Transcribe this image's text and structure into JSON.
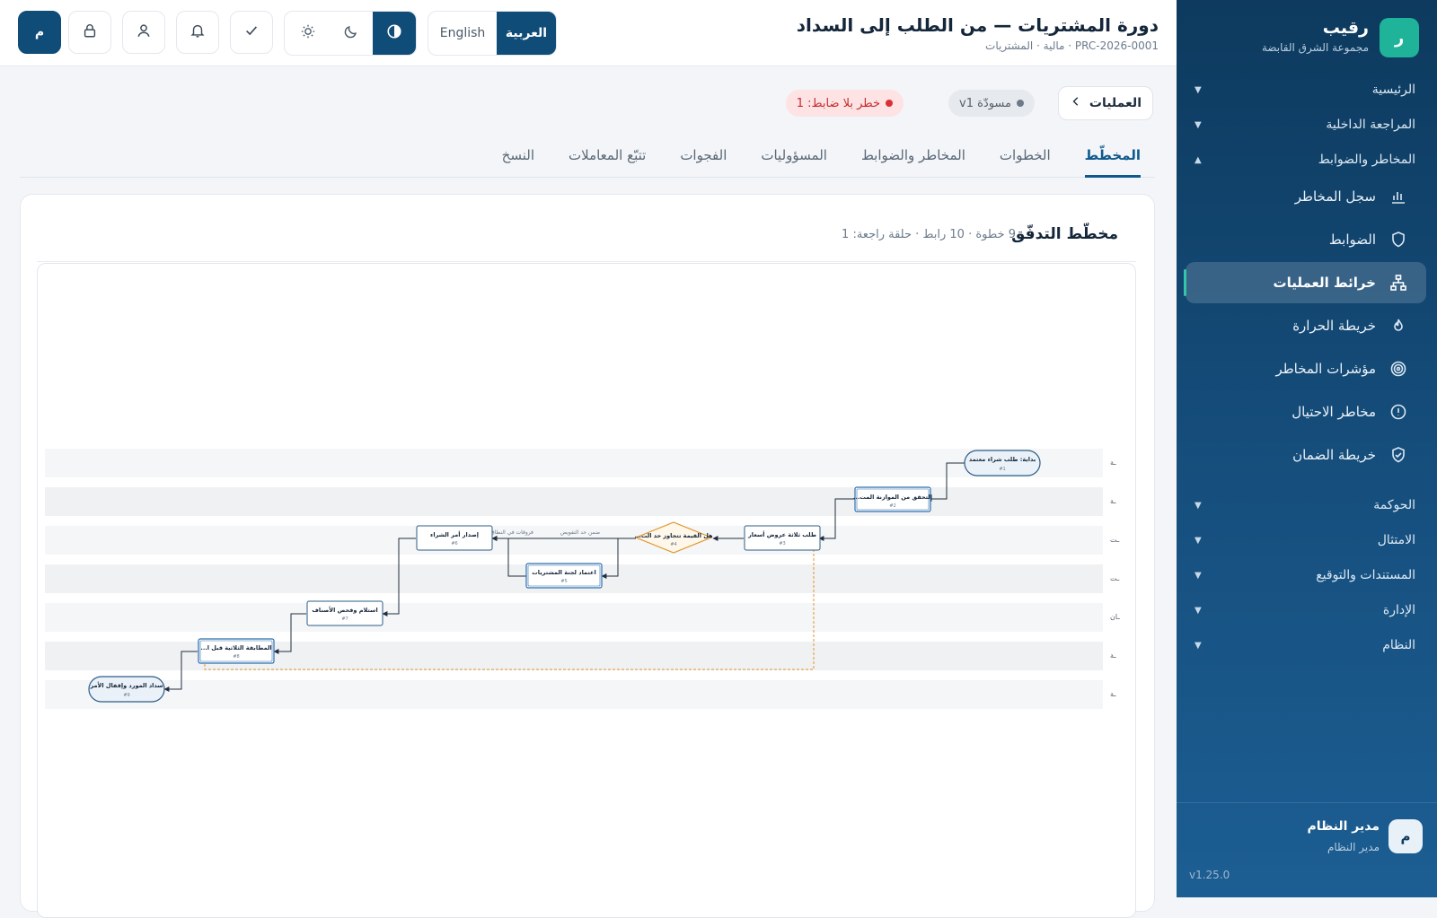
{
  "brand": {
    "logo": "ر",
    "name": "رقيب",
    "org": "مجموعة الشرق القابضة"
  },
  "sidebar": {
    "sections": [
      {
        "label": "الرئيسية",
        "caret": "▼"
      },
      {
        "label": "المراجعة الداخلية",
        "caret": "▼"
      },
      {
        "label": "المخاطر والضوابط",
        "caret": "▲"
      },
      {
        "label": "الحوكمة",
        "caret": "▼"
      },
      {
        "label": "الامتثال",
        "caret": "▼"
      },
      {
        "label": "المستندات والتوقيع",
        "caret": "▼"
      },
      {
        "label": "الإدارة",
        "caret": "▼"
      },
      {
        "label": "النظام",
        "caret": "▼"
      }
    ],
    "items": [
      {
        "label": "سجل المخاطر",
        "icon": "bar-chart-icon"
      },
      {
        "label": "الضوابط",
        "icon": "shield-icon"
      },
      {
        "label": "خرائط العمليات",
        "icon": "sitemap-icon",
        "active": true
      },
      {
        "label": "خريطة الحرارة",
        "icon": "flame-icon"
      },
      {
        "label": "مؤشرات المخاطر",
        "icon": "target-icon"
      },
      {
        "label": "مخاطر الاحتيال",
        "icon": "alert-circle-icon"
      },
      {
        "label": "خريطة الضمان",
        "icon": "shield-check-icon"
      }
    ],
    "user": {
      "avatar": "م",
      "name": "مدير النظام",
      "role": "مدير النظام"
    },
    "version": "v1.25.0"
  },
  "header": {
    "title": "دورة المشتريات — من الطلب إلى السداد",
    "subtitle": "PRC-2026-0001 · مالية · المشتريات",
    "lang_ar": "العربية",
    "lang_en": "English",
    "avatar": "م"
  },
  "breadcrumb": {
    "label": "العمليات"
  },
  "badges": {
    "draft": "مسودّة v1",
    "risk": "خطر بلا ضابط: 1"
  },
  "tabs": [
    "المخطّط",
    "الخطوات",
    "المخاطر والضوابط",
    "المسؤوليات",
    "الفجوات",
    "تتبّع المعاملات",
    "النسخ"
  ],
  "diagram": {
    "title": "مخطّط التدفّق",
    "meta": "9 خطوة · 10 رابط · حلقة راجعة: 1",
    "lanes": [
      "ـة",
      "ـة",
      "ـت",
      "ـت",
      "ـان",
      "ـة",
      "ـة"
    ],
    "nodes": [
      {
        "label": "بداية: طلب شراء معتمد",
        "num": "#1"
      },
      {
        "label": "التحقق من الموازنة المت...",
        "num": "#2"
      },
      {
        "label": "طلب ثلاثة عروض أسعار",
        "num": "#3"
      },
      {
        "label": "هل القيمة تتجاوز حد الت...",
        "num": "#4"
      },
      {
        "label": "اعتماد لجنة المشتريات",
        "num": "#5"
      },
      {
        "label": "إصدار أمر الشراء",
        "num": "#6"
      },
      {
        "label": "استلام وفحص الأصناف",
        "num": "#7"
      },
      {
        "label": "المطابقة الثلاثية قبل ا...",
        "num": "#8"
      },
      {
        "label": "سداد المورد وإقفال الأمر",
        "num": "#9"
      }
    ],
    "edge_labels": {
      "within": "ضمن حد التفويض",
      "above": "فروقات في النطاق"
    }
  }
}
